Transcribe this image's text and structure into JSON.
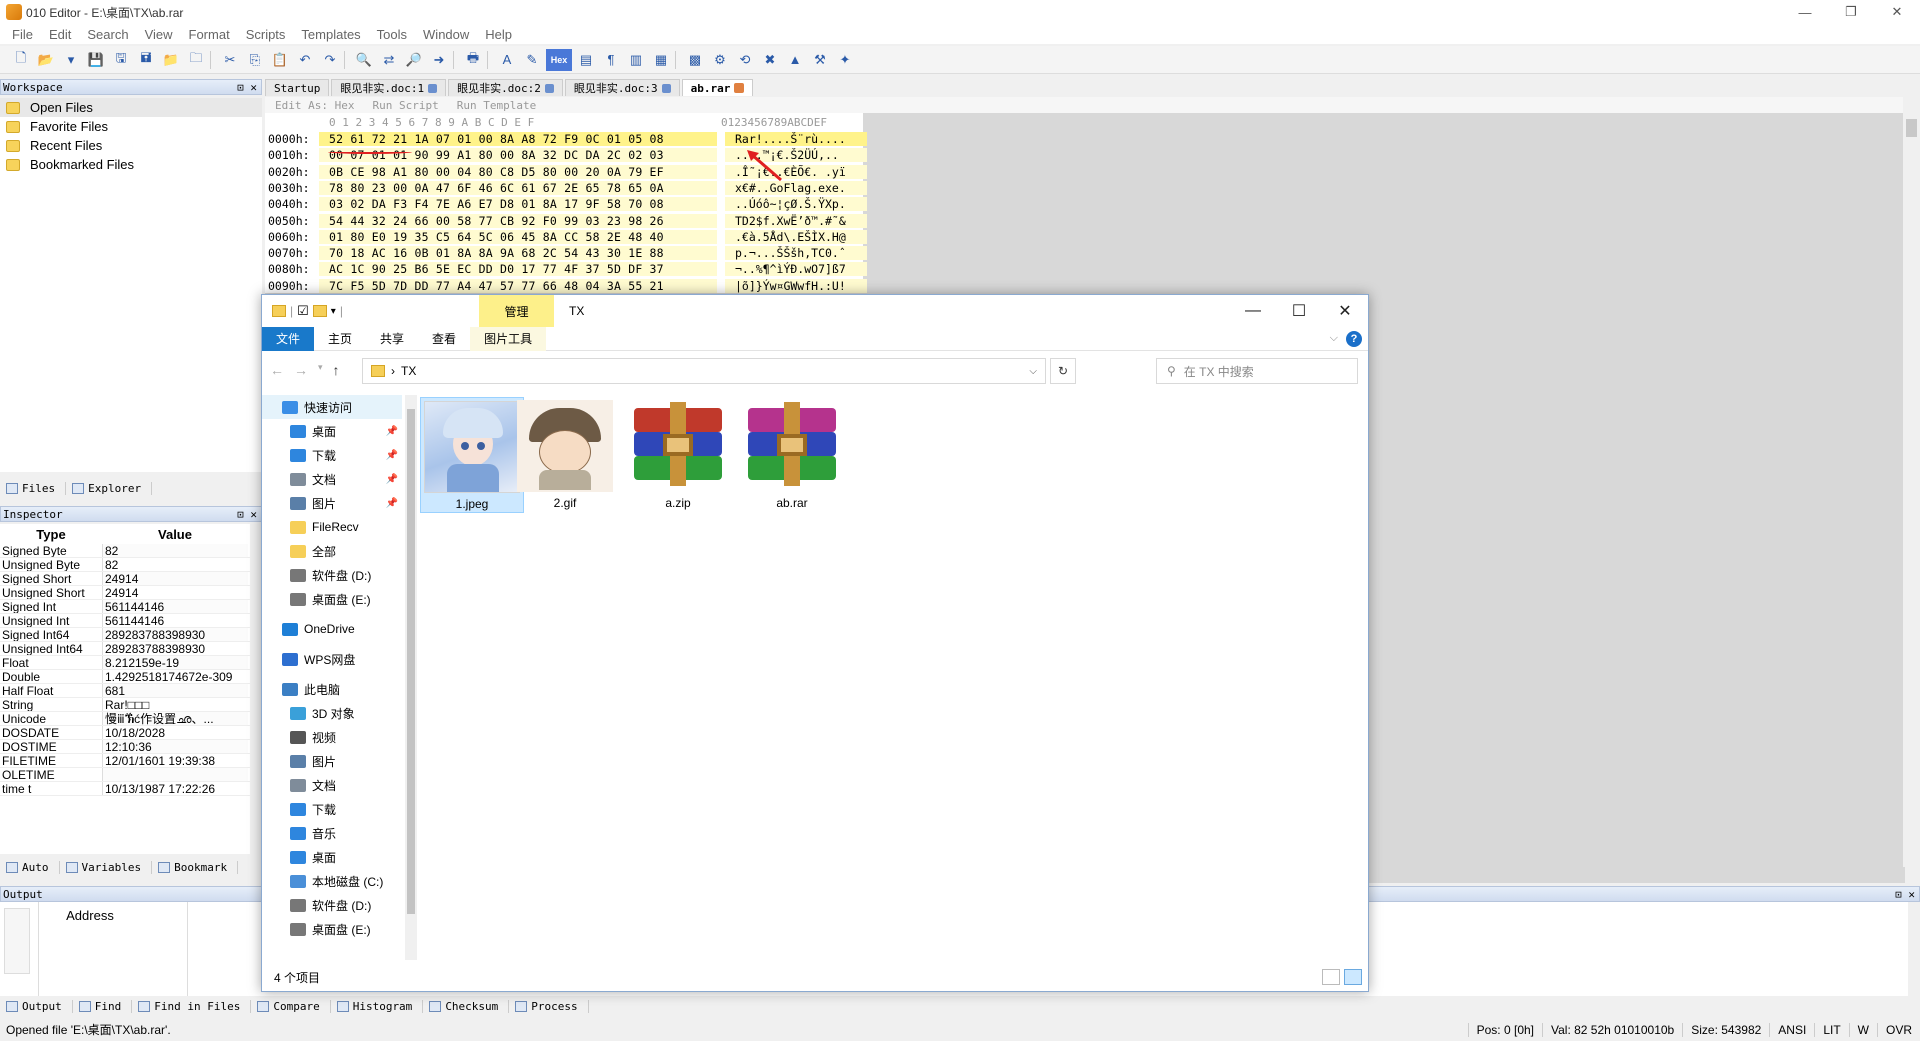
{
  "window": {
    "title": "010 Editor - E:\\桌面\\TX\\ab.rar",
    "controls": [
      "—",
      "❐",
      "✕"
    ]
  },
  "menu": [
    "File",
    "Edit",
    "Search",
    "View",
    "Format",
    "Scripts",
    "Templates",
    "Tools",
    "Window",
    "Help"
  ],
  "toolbar": {
    "hex_label": "Hex"
  },
  "workspace": {
    "title": "Workspace",
    "items": [
      "Open Files",
      "Favorite Files",
      "Recent Files",
      "Bookmarked Files"
    ],
    "bottom_tabs": [
      "Files",
      "Explorer"
    ]
  },
  "inspector": {
    "title": "Inspector",
    "col_type": "Type",
    "col_value": "Value",
    "rows": [
      {
        "type": "Signed Byte",
        "value": "82"
      },
      {
        "type": "Unsigned Byte",
        "value": "82"
      },
      {
        "type": "Signed Short",
        "value": "24914"
      },
      {
        "type": "Unsigned Short",
        "value": "24914"
      },
      {
        "type": "Signed Int",
        "value": "561144146"
      },
      {
        "type": "Unsigned Int",
        "value": "561144146"
      },
      {
        "type": "Signed Int64",
        "value": "289283788398930"
      },
      {
        "type": "Unsigned Int64",
        "value": "289283788398930"
      },
      {
        "type": "Float",
        "value": "8.212159e-19"
      },
      {
        "type": "Double",
        "value": "1.4292518174672e-309"
      },
      {
        "type": "Half Float",
        "value": "681"
      },
      {
        "type": "String",
        "value": "Rar!□□□"
      },
      {
        "type": "Unicode",
        "value": "慢ⅲⷕć作设置ഛ、..."
      },
      {
        "type": "DOSDATE",
        "value": "10/18/2028"
      },
      {
        "type": "DOSTIME",
        "value": "12:10:36"
      },
      {
        "type": "FILETIME",
        "value": "12/01/1601 19:39:38"
      },
      {
        "type": "OLETIME",
        "value": ""
      },
      {
        "type": "time t",
        "value": "10/13/1987 17:22:26"
      }
    ],
    "bottom_tabs": [
      "Auto",
      "Variables",
      "Bookmark"
    ]
  },
  "editor": {
    "tabs": [
      {
        "label": "Startup",
        "locked": false,
        "active": false
      },
      {
        "label": "眼见非实.doc:1",
        "locked": true,
        "active": false
      },
      {
        "label": "眼见非实.doc:2",
        "locked": true,
        "active": false
      },
      {
        "label": "眼见非实.doc:3",
        "locked": true,
        "active": false
      },
      {
        "label": "ab.rar",
        "locked": false,
        "active": true
      }
    ],
    "bar": [
      "Edit As: Hex",
      "Run Script",
      "Run Template"
    ],
    "col_header_hex": "0  1  2  3  4  5  6  7  8  9  A  B  C  D  E  F",
    "col_header_ascii": "0123456789ABCDEF",
    "rows": [
      {
        "addr": "0000h:",
        "hex": "52 61 72 21 1A 07 01 00 8A A8 72 F9 0C 01 05 08",
        "ascii": "Rar!....Š¨rù...."
      },
      {
        "addr": "0010h:",
        "hex": "00 07 01 01 90 99 A1 80 00 8A 32 DC DA 2C 02 03",
        "ascii": "....™¡€.Š2ÜÚ,.."
      },
      {
        "addr": "0020h:",
        "hex": "0B CE 98 A1 80 00 04 80 C8 D5 80 00 20 0A 79 EF",
        "ascii": ".Î˜¡€..€ÈÕ€. .yï"
      },
      {
        "addr": "0030h:",
        "hex": "78 80 23 00 0A 47 6F 46 6C 61 67 2E 65 78 65 0A",
        "ascii": "x€#..GoFlag.exe."
      },
      {
        "addr": "0040h:",
        "hex": "03 02 DA F3 F4 7E A6 E7 D8 01 8A 17 9F 58 70 08",
        "ascii": "..Úóô~¦çØ.Š.ŸXp."
      },
      {
        "addr": "0050h:",
        "hex": "54 44 32 24 66 00 58 77 CB 92 F0 99 03 23 98 26",
        "ascii": "TD2$f.XwË’ð™.#˜&"
      },
      {
        "addr": "0060h:",
        "hex": "01 80 E0 19 35 C5 64 5C 06 45 8A CC 58 2E 48 40",
        "ascii": ".€à.5Åd\\.EŠÌX.H@"
      },
      {
        "addr": "0070h:",
        "hex": "70 18 AC 16 0B 01 8A 8A 9A 68 2C 54 43 30 1E 88",
        "ascii": "p.¬...ŠŠšh,TC0.ˆ"
      },
      {
        "addr": "0080h:",
        "hex": "AC 1C 90 25 B6 5E EC DD D0 17 77 4F 37 5D DF 37",
        "ascii": "¬..%¶^ìÝÐ.wO7]ß7"
      },
      {
        "addr": "0090h:",
        "hex": "7C F5 5D 7D DD 77 A4 47 57 77 66 48 04 3A 55 21",
        "ascii": "|õ]}Ýw¤GWwfH.:U!"
      }
    ]
  },
  "output": {
    "title": "Output",
    "col_address": "Address",
    "tabs": [
      "Output",
      "Find",
      "Find in Files",
      "Compare",
      "Histogram",
      "Checksum",
      "Process"
    ]
  },
  "status": {
    "message": "Opened file 'E:\\桌面\\TX\\ab.rar'.",
    "pos": "Pos: 0 [0h]",
    "val": "Val: 82 52h 01010010b",
    "size": "Size: 543982",
    "enc": "ANSI",
    "lit": "LIT",
    "w": "W",
    "ovr": "OVR"
  },
  "explorer": {
    "title": "TX",
    "manage": "管理",
    "ribbon": {
      "file": "文件",
      "home": "主页",
      "share": "共享",
      "view": "查看",
      "picture_tools": "图片工具"
    },
    "path": "TX",
    "search_placeholder": "在 TX 中搜索",
    "nav": [
      {
        "label": "快速访问",
        "level": 0,
        "icon": "star-icon",
        "color": "#3a8ee6",
        "pinned": false,
        "selected": true
      },
      {
        "label": "桌面",
        "level": 1,
        "icon": "desktop-icon",
        "color": "#2e86de",
        "pinned": true
      },
      {
        "label": "下载",
        "level": 1,
        "icon": "download-icon",
        "color": "#2e86de",
        "pinned": true
      },
      {
        "label": "文档",
        "level": 1,
        "icon": "document-icon",
        "color": "#7f8c9a",
        "pinned": true
      },
      {
        "label": "图片",
        "level": 1,
        "icon": "picture-icon",
        "color": "#5a7fa8",
        "pinned": true
      },
      {
        "label": "FileRecv",
        "level": 1,
        "icon": "folder-icon",
        "color": "#f6cf58",
        "pinned": false
      },
      {
        "label": "全部",
        "level": 1,
        "icon": "folder-icon",
        "color": "#f6cf58",
        "pinned": false
      },
      {
        "label": "软件盘 (D:)",
        "level": 1,
        "icon": "drive-icon",
        "color": "#777777",
        "pinned": false
      },
      {
        "label": "桌面盘 (E:)",
        "level": 1,
        "icon": "drive-icon",
        "color": "#777777",
        "pinned": false
      },
      {
        "label": "OneDrive",
        "level": 0,
        "icon": "cloud-icon",
        "color": "#1e7fd6",
        "pinned": false
      },
      {
        "label": "WPS网盘",
        "level": 0,
        "icon": "cloud-icon",
        "color": "#2d6fd0",
        "pinned": false
      },
      {
        "label": "此电脑",
        "level": 0,
        "icon": "computer-icon",
        "color": "#3b7fc4",
        "pinned": false
      },
      {
        "label": "3D 对象",
        "level": 1,
        "icon": "cube-icon",
        "color": "#3aa0d9",
        "pinned": false
      },
      {
        "label": "视频",
        "level": 1,
        "icon": "video-icon",
        "color": "#555555",
        "pinned": false
      },
      {
        "label": "图片",
        "level": 1,
        "icon": "picture-icon",
        "color": "#5a7fa8",
        "pinned": false
      },
      {
        "label": "文档",
        "level": 1,
        "icon": "document-icon",
        "color": "#7f8c9a",
        "pinned": false
      },
      {
        "label": "下载",
        "level": 1,
        "icon": "download-icon",
        "color": "#2e86de",
        "pinned": false
      },
      {
        "label": "音乐",
        "level": 1,
        "icon": "music-icon",
        "color": "#2e86de",
        "pinned": false
      },
      {
        "label": "桌面",
        "level": 1,
        "icon": "desktop-icon",
        "color": "#2e86de",
        "pinned": false
      },
      {
        "label": "本地磁盘 (C:)",
        "level": 1,
        "icon": "drive-icon",
        "color": "#4a8fd8",
        "pinned": false
      },
      {
        "label": "软件盘 (D:)",
        "level": 1,
        "icon": "drive-icon",
        "color": "#777777",
        "pinned": false
      },
      {
        "label": "桌面盘 (E:)",
        "level": 1,
        "icon": "drive-icon",
        "color": "#777777",
        "pinned": false
      }
    ],
    "files": [
      {
        "name": "1.jpeg",
        "kind": "image",
        "selected": true
      },
      {
        "name": "2.gif",
        "kind": "image",
        "selected": false
      },
      {
        "name": "a.zip",
        "kind": "archive",
        "selected": false
      },
      {
        "name": "ab.rar",
        "kind": "archive",
        "selected": false
      }
    ],
    "status": "4 个项目"
  },
  "colors": {
    "hex_highlight": "#fff38a",
    "hex_bg": "#fffbd0",
    "explorer_file_tab": "#1979ca",
    "manage_tab": "#fdf08a",
    "annotation_red": "#e02020"
  }
}
